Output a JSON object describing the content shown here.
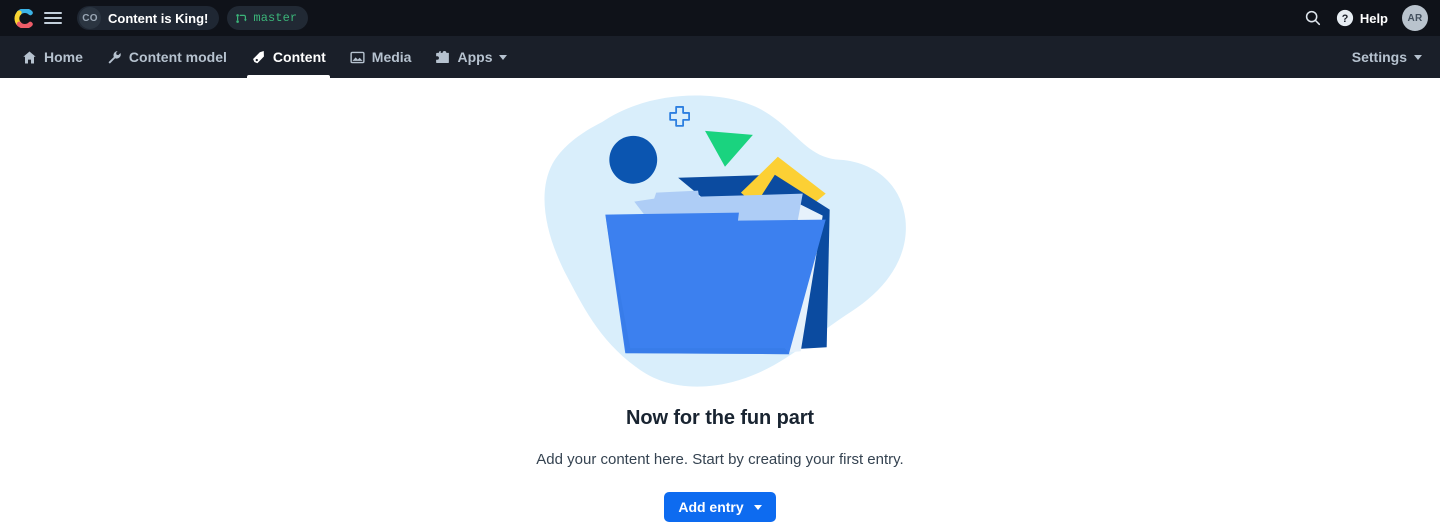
{
  "topbar": {
    "logo_icon": "contentful-logo-icon",
    "menu_icon": "hamburger-menu-icon",
    "space_initials": "CO",
    "space_name": "Content is King!",
    "environment_icon": "branch-icon",
    "environment_name": "master",
    "search_icon": "search-icon",
    "help_icon": "question-circle-icon",
    "help_label": "Help",
    "user_initials": "AR"
  },
  "nav": {
    "items": [
      {
        "label": "Home",
        "icon": "home-icon",
        "active": false,
        "dropdown": false
      },
      {
        "label": "Content model",
        "icon": "wrench-icon",
        "active": false,
        "dropdown": false
      },
      {
        "label": "Content",
        "icon": "pen-nib-icon",
        "active": true,
        "dropdown": false
      },
      {
        "label": "Media",
        "icon": "image-icon",
        "active": false,
        "dropdown": false
      },
      {
        "label": "Apps",
        "icon": "puzzle-piece-icon",
        "active": false,
        "dropdown": true
      }
    ],
    "settings_label": "Settings",
    "settings_caret_icon": "chevron-down-icon"
  },
  "main": {
    "illustration_name": "empty-folder-illustration",
    "title": "Now for the fun part",
    "subtitle": "Add your content here. Start by creating your first entry.",
    "add_entry_label": "Add entry",
    "add_entry_caret_icon": "chevron-down-icon"
  },
  "colors": {
    "topbar_bg": "#0f1219",
    "navbar_bg": "#1a1f29",
    "accent_blue": "#0d6bf0",
    "env_green": "#3bb579",
    "text_dark": "#192431",
    "illustration_blob": "#d9eefb",
    "illustration_folder_front": "#3c80ef",
    "illustration_folder_back": "#0b4ba0",
    "illustration_green": "#1ad37f",
    "illustration_yellow": "#fcd034"
  }
}
